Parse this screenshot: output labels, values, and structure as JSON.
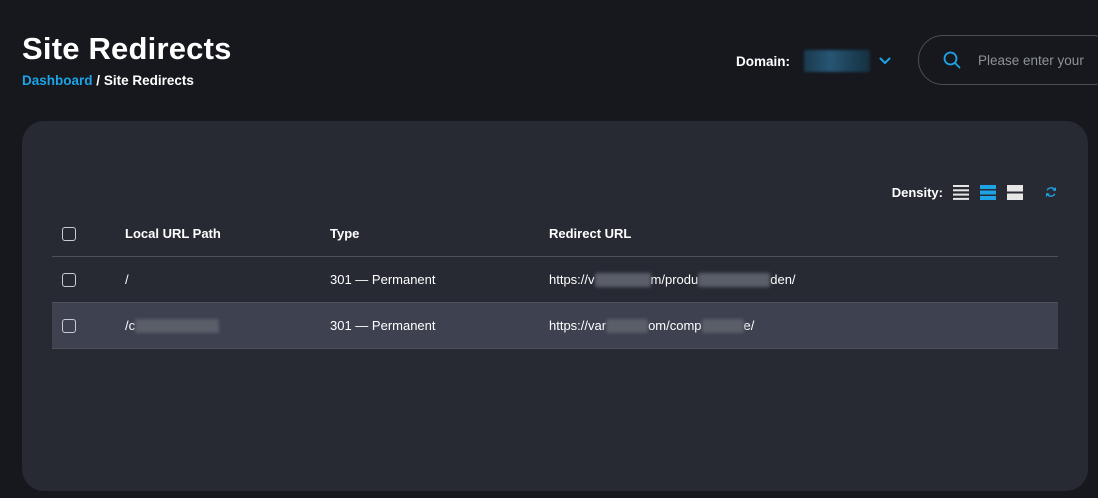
{
  "header": {
    "title": "Site Redirects",
    "breadcrumb": {
      "link": "Dashboard",
      "separator": "/",
      "current": "Site Redirects"
    }
  },
  "domain": {
    "label": "Domain:"
  },
  "search": {
    "placeholder": "Please enter your"
  },
  "density": {
    "label": "Density:",
    "options": [
      "compact",
      "standard",
      "comfortable"
    ],
    "selected": "standard"
  },
  "colors": {
    "accent": "#1ea3e6",
    "background": "#16181e",
    "card": "#272a33",
    "row_highlight": "#3d4150"
  },
  "table": {
    "columns": [
      "Local URL Path",
      "Type",
      "Redirect URL"
    ],
    "rows": [
      {
        "path_start": "/",
        "type": "301 — Permanent",
        "redirect_part1": "https://v",
        "redirect_part2": "m/produ",
        "redirect_part3": "den/"
      },
      {
        "path_start": "/c",
        "type": "301 — Permanent",
        "redirect_part1": "https://var",
        "redirect_part2": "om/comp",
        "redirect_part3": "e/"
      }
    ]
  }
}
